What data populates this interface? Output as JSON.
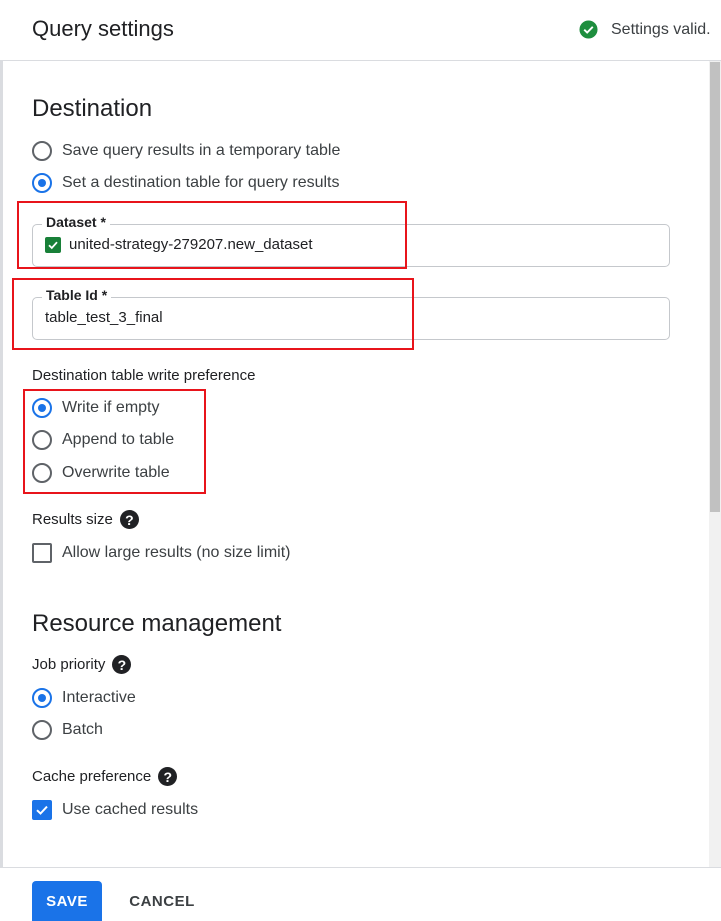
{
  "header": {
    "title": "Query settings",
    "status_text": "Settings valid.",
    "status_icon": "check-circle-icon",
    "status_color": "#1e8e3e"
  },
  "destination": {
    "title": "Destination",
    "options": [
      {
        "label": "Save query results in a temporary table",
        "selected": false
      },
      {
        "label": "Set a destination table for query results",
        "selected": true
      }
    ],
    "dataset_field": {
      "label": "Dataset *",
      "value": "united-strategy-279207.new_dataset"
    },
    "table_field": {
      "label": "Table Id *",
      "value": "table_test_3_final"
    },
    "write_pref": {
      "label": "Destination table write preference",
      "options": [
        {
          "label": "Write if empty",
          "selected": true
        },
        {
          "label": "Append to table",
          "selected": false
        },
        {
          "label": "Overwrite table",
          "selected": false
        }
      ]
    },
    "results_size": {
      "label": "Results size",
      "help_glyph": "?",
      "checkbox_label": "Allow large results (no size limit)",
      "checked": false
    }
  },
  "resource": {
    "title": "Resource management",
    "job_priority": {
      "label": "Job priority",
      "help_glyph": "?",
      "options": [
        {
          "label": "Interactive",
          "selected": true
        },
        {
          "label": "Batch",
          "selected": false
        }
      ]
    },
    "cache": {
      "label": "Cache preference",
      "help_glyph": "?",
      "checkbox_label": "Use cached results",
      "checked": true
    }
  },
  "footer": {
    "save_label": "SAVE",
    "cancel_label": "CANCEL"
  },
  "colors": {
    "accent": "#1a73e8",
    "highlight": "#e8141b"
  }
}
